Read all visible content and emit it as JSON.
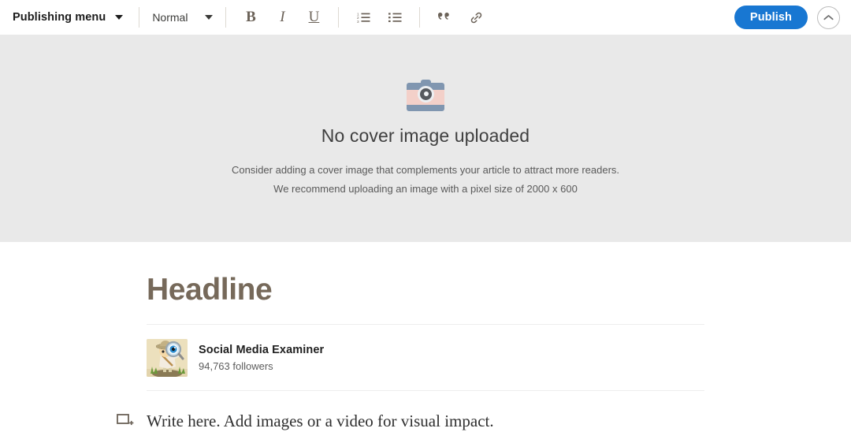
{
  "toolbar": {
    "publishing_menu_label": "Publishing menu",
    "publishing_menu_caret": "caret-down-icon",
    "style_value": "Normal",
    "style_caret": "caret-down-icon",
    "bold_label": "B",
    "italic_label": "I",
    "underline_label": "U",
    "numbered_list_icon": "numbered-list-icon",
    "bulleted_list_icon": "bulleted-list-icon",
    "quote_icon": "quote-icon",
    "link_icon": "link-icon",
    "publish_label": "Publish",
    "collapse_icon": "chevron-up-icon",
    "publish_color": "#1877d2"
  },
  "cover": {
    "camera_icon": "camera-icon",
    "title": "No cover image uploaded",
    "subtitle_line1": "Consider adding a cover image that complements your article to attract more readers.",
    "subtitle_line2": "We recommend uploading an image with a pixel size of 2000 x 600",
    "background_color": "#e9e9e9"
  },
  "article": {
    "headline_placeholder": "Headline",
    "headline_color": "#76695a",
    "author": {
      "avatar_icon": "explorer-avatar",
      "name": "Social Media Examiner",
      "followers": "94,763 followers"
    },
    "body": {
      "add_block_icon": "add-block-icon",
      "placeholder": "Write here. Add images or a video for visual impact."
    }
  }
}
